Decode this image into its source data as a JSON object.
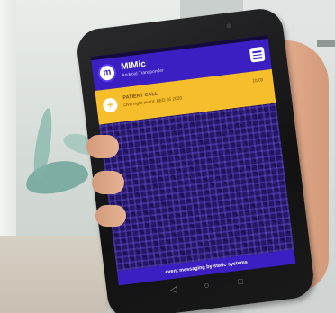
{
  "app": {
    "title": "MIMic",
    "subtitle": "Android Transponder",
    "logo_glyph": "m"
  },
  "notification": {
    "title": "PATIENT CALL",
    "detail": "Overnight event: BED 06 2020",
    "time": "10:03",
    "icon": "plus-icon"
  },
  "footer": {
    "text": "event messaging by static systems"
  },
  "nav": {
    "back": "◁",
    "home": "○",
    "recent": "□"
  },
  "colors": {
    "header": "#3b1fc2",
    "notification": "#f5be2a",
    "screen_background": "#241663"
  }
}
